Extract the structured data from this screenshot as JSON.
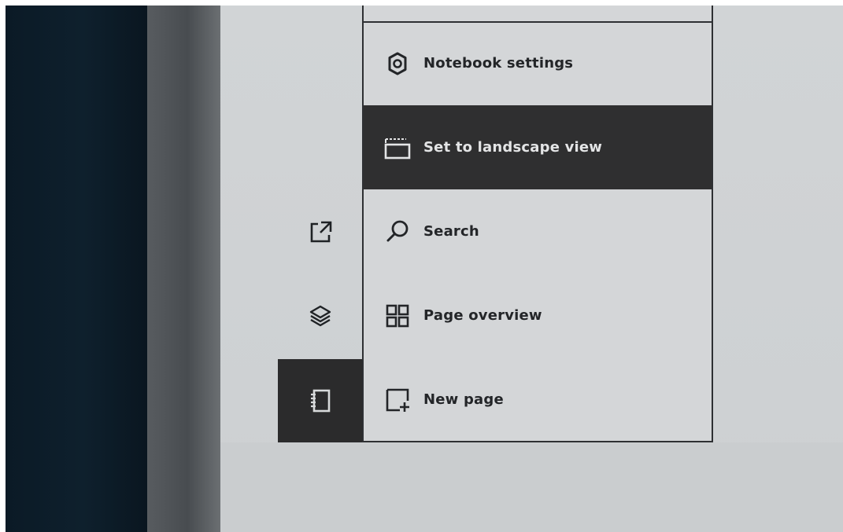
{
  "menu": {
    "items": [
      {
        "label": "Notebook settings",
        "icon": "gear-icon"
      },
      {
        "label": "Set to landscape view",
        "icon": "landscape-icon",
        "active": true
      },
      {
        "label": "Search",
        "icon": "search-icon"
      },
      {
        "label": "Page overview",
        "icon": "grid-icon"
      },
      {
        "label": "New page",
        "icon": "new-page-icon"
      }
    ]
  },
  "toolbar": {
    "buttons": [
      {
        "icon": "export-icon"
      },
      {
        "icon": "layers-icon"
      },
      {
        "icon": "notebook-icon",
        "active": true
      }
    ]
  },
  "colors": {
    "screen": "#d1d4d6",
    "active": "#2f2f30",
    "border": "#2e3033"
  }
}
